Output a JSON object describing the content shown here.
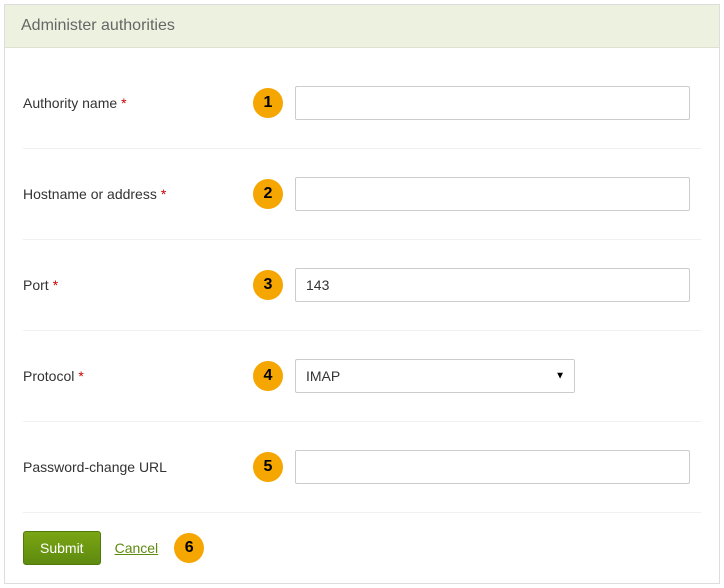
{
  "header": {
    "title": "Administer authorities"
  },
  "form": {
    "fields": [
      {
        "badge": "1",
        "label": "Authority name",
        "required": true,
        "value": "",
        "type": "text"
      },
      {
        "badge": "2",
        "label": "Hostname or address",
        "required": true,
        "value": "",
        "type": "text"
      },
      {
        "badge": "3",
        "label": "Port",
        "required": true,
        "value": "143",
        "type": "text"
      },
      {
        "badge": "4",
        "label": "Protocol",
        "required": true,
        "value": "IMAP",
        "type": "select",
        "options": [
          "IMAP"
        ]
      },
      {
        "badge": "5",
        "label": "Password-change URL",
        "required": false,
        "value": "",
        "type": "text"
      }
    ],
    "required_marker": "*"
  },
  "actions": {
    "submit_label": "Submit",
    "cancel_label": "Cancel",
    "badge": "6"
  }
}
